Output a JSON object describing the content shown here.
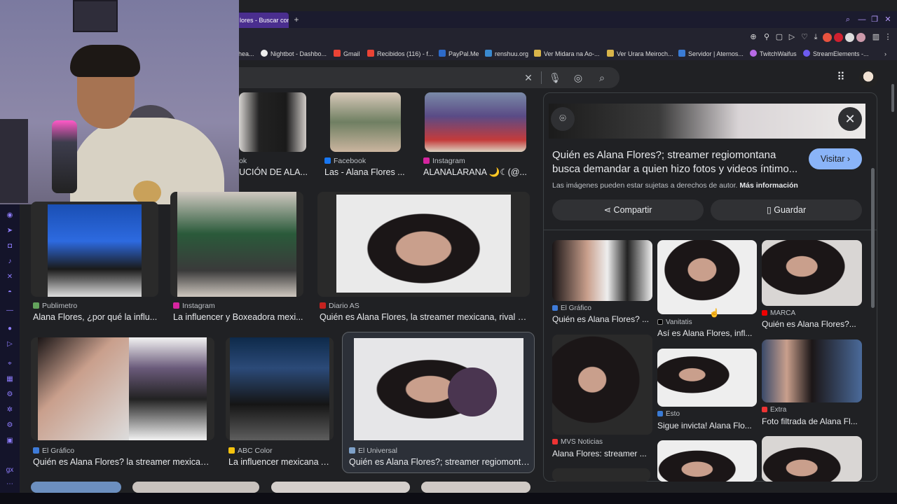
{
  "browser": {
    "active_tab_title": "lores - Buscar con",
    "new_tab": "+",
    "bookmarks": [
      {
        "label": "hea..."
      },
      {
        "label": "Nightbot - Dashbo..."
      },
      {
        "label": "Gmail"
      },
      {
        "label": "Recibidos (116) - f..."
      },
      {
        "label": "PayPal.Me"
      },
      {
        "label": "renshuu.org"
      },
      {
        "label": "Ver Midara na Ao-..."
      },
      {
        "label": "Ver Urara Meiroch..."
      },
      {
        "label": "Servidor | Aternos..."
      },
      {
        "label": "TwitchWaifus"
      },
      {
        "label": "StreamElements -..."
      }
    ]
  },
  "grid": {
    "row1": [
      {
        "source": "ok",
        "title": "UCIÓN DE ALA..."
      },
      {
        "source": "Facebook",
        "title": "Las - Alana Flores ..."
      },
      {
        "source": "Instagram",
        "title": "ALANALARANA 🌙☾(@..."
      }
    ],
    "row2": [
      {
        "source": "Publimetro",
        "title": "Alana Flores, ¿por qué la influ..."
      },
      {
        "source": "Instagram",
        "title": "La influencer y Boxeadora mexi..."
      },
      {
        "source": "Diario AS",
        "title": "Quién es Alana Flores, la streamer mexicana, rival de..."
      }
    ],
    "row3": [
      {
        "source": "El Gráfico",
        "title": "Quién es Alana Flores? la streamer mexicana..."
      },
      {
        "source": "ABC Color",
        "title": "La influencer mexicana Al..."
      },
      {
        "source": "El Universal",
        "title": "Quién es Alana Flores?; streamer regiomonta..."
      }
    ]
  },
  "panel": {
    "title": "Quién es Alana Flores?; streamer regiomontana busca demandar a quien hizo fotos y videos íntimo...",
    "visit_label": "Visitar",
    "copyright_text": "Las imágenes pueden estar sujetas a derechos de autor.",
    "more_info": "Más información",
    "share_label": "Compartir",
    "save_label": "Guardar",
    "related": [
      {
        "source": "El Gráfico",
        "title": "Quién es Alana Flores? ..."
      },
      {
        "source": "Vanitatis",
        "title": "Así es Alana Flores, infl..."
      },
      {
        "source": "MARCA",
        "title": "Quién es Alana Flores?..."
      },
      {
        "source": "MVS Noticias",
        "title": "Alana Flores: streamer ..."
      },
      {
        "source": "Esto",
        "title": "Sigue invicta! Alana Flo..."
      },
      {
        "source": "Extra",
        "title": "Foto filtrada de Alana Fl..."
      }
    ]
  },
  "colors": {
    "accent": "#8ab4f8",
    "background": "#202124",
    "tab_active": "#4a2e8f"
  }
}
